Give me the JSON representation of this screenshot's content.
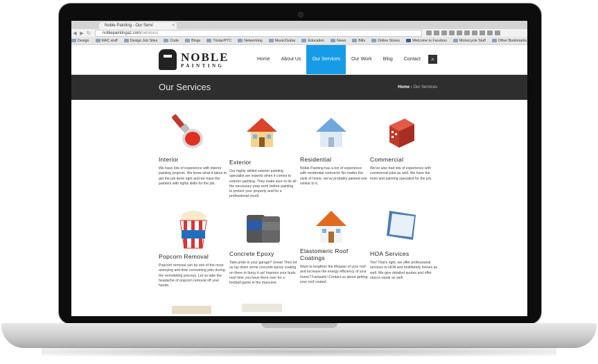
{
  "browser": {
    "tab_title": "Noble Painting - Our Servi",
    "tab_close": "×",
    "url_host": "noblepaintingaz.com",
    "url_path": "/services/",
    "bookmarks": [
      "Design",
      "MAC stuff",
      "Design Job Sites",
      "Code",
      "Blogs",
      "Tristar/PTC",
      "Networking",
      "Music/Guitar",
      "Education",
      "News",
      "Bills",
      "Online Stores",
      "Welcome to Faceboo",
      "Motorcycle Stuff"
    ],
    "other_bookmarks": "Other Bookmarks"
  },
  "site": {
    "logo_big": "NOBLE",
    "logo_small": "PAINTING",
    "menu": [
      "Home",
      "About Us",
      "Our Services",
      "Our Work",
      "Blog",
      "Contact"
    ],
    "search_icon": "search-icon",
    "page_title": "Our Services",
    "breadcrumb_home": "Home",
    "breadcrumb_sep": "›",
    "breadcrumb_current": "Our Services",
    "accent": "#169ce6"
  },
  "services": [
    {
      "title": "Interior",
      "desc": "We have lots of experience with interior painting projects. We know what it takes to get the job done right and we have the painters with rights skills for the job.",
      "icon": "paint-bucket-icon"
    },
    {
      "title": "Exterior",
      "desc": "Our highly skilled exterior painting specialist are experts when it comes to exterior painting. They make sure to do all the necessary prep work before painting to protect your property and for a professional result.",
      "icon": "house-icon"
    },
    {
      "title": "Residential",
      "desc": "Noble Painting has a ton of experience with residential contracts! No matter the style of home, we've probably painted one similar to it.",
      "icon": "home-icon"
    },
    {
      "title": "Commercial",
      "desc": "We've also had lots of experience with commercial jobs as well. We have the tools and painting specialist for the job.",
      "icon": "building-icon"
    },
    {
      "title": "Popcorn Removal",
      "desc": "Popcorn removal can be one of the most annoying and time consuming jobs during the remodeling process. Let us take the headache of popcorn removal off your hands.",
      "icon": "popcorn-icon"
    },
    {
      "title": "Concrete Epoxy",
      "desc": "Take pride in your garage? Great! Then let us lay down some concrete epoxy coating on there to fancy it up! Impress your buds next time you have them over for a football game in the mancave.",
      "icon": "epoxy-cans-icon"
    },
    {
      "title": "Elastomeric Roof Coatings",
      "desc": "Want to lengthen the lifespan of your roof and increase the energy efficiency of your home? Fantastic! Contact us about getting your roof coated.",
      "icon": "roof-house-icon"
    },
    {
      "title": "HOA Services",
      "desc": "Yes! That's right, we offer professional services to HOA and multifamily homes as well. We give detailed quotes and offer stucco repair as well.",
      "icon": "hoa-page-icon"
    }
  ]
}
